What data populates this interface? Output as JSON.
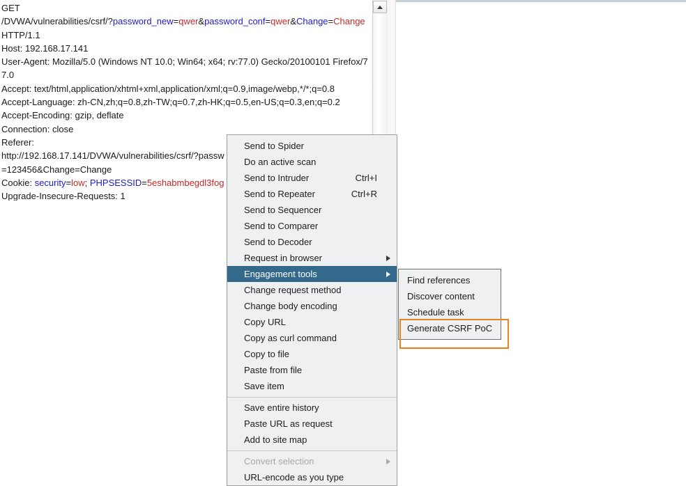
{
  "request": {
    "lines": [
      [
        {
          "t": "GET",
          "c": "plain"
        }
      ],
      [
        {
          "t": "/DVWA/vulnerabilities/csrf/?",
          "c": "plain"
        },
        {
          "t": "password_new",
          "c": "name"
        },
        {
          "t": "=",
          "c": "plain"
        },
        {
          "t": "qwer",
          "c": "value"
        },
        {
          "t": "&",
          "c": "plain"
        },
        {
          "t": "password_conf",
          "c": "name"
        },
        {
          "t": "=",
          "c": "plain"
        },
        {
          "t": "qwer",
          "c": "value"
        },
        {
          "t": "&",
          "c": "plain"
        },
        {
          "t": "Change",
          "c": "name"
        },
        {
          "t": "=",
          "c": "plain"
        },
        {
          "t": "Change",
          "c": "value"
        },
        {
          "t": " HTTP/1.1",
          "c": "plain"
        }
      ],
      [
        {
          "t": "Host: 192.168.17.141",
          "c": "plain"
        }
      ],
      [
        {
          "t": "User-Agent: Mozilla/5.0 (Windows NT 10.0; Win64; x64; rv:77.0) Gecko/20100101 Firefox/77.0",
          "c": "plain"
        }
      ],
      [
        {
          "t": "Accept: text/html,application/xhtml+xml,application/xml;q=0.9,image/webp,*/*;q=0.8",
          "c": "plain"
        }
      ],
      [
        {
          "t": "Accept-Language: zh-CN,zh;q=0.8,zh-TW;q=0.7,zh-HK;q=0.5,en-US;q=0.3,en;q=0.2",
          "c": "plain"
        }
      ],
      [
        {
          "t": "Accept-Encoding: gzip, deflate",
          "c": "plain"
        }
      ],
      [
        {
          "t": "Connection: close",
          "c": "plain"
        }
      ],
      [
        {
          "t": "Referer:",
          "c": "plain"
        }
      ],
      [
        {
          "t": "http://192.168.17.141/DVWA/vulnerabilities/csrf/?passw",
          "c": "plain"
        }
      ],
      [
        {
          "t": "=123456&Change=Change",
          "c": "plain"
        }
      ],
      [
        {
          "t": "Cookie: ",
          "c": "plain"
        },
        {
          "t": "security",
          "c": "name"
        },
        {
          "t": "=",
          "c": "plain"
        },
        {
          "t": "low",
          "c": "value"
        },
        {
          "t": "; ",
          "c": "plain"
        },
        {
          "t": "PHPSESSID",
          "c": "name"
        },
        {
          "t": "=",
          "c": "plain"
        },
        {
          "t": "5eshabmbegdl3fog",
          "c": "value"
        }
      ],
      [
        {
          "t": "Upgrade-Insecure-Requests: 1",
          "c": "plain"
        }
      ]
    ]
  },
  "scrollbar": {
    "up_arrow_icon": "triangle-up-icon"
  },
  "context_menu": {
    "items": [
      {
        "label": "Send to Spider",
        "accel": "",
        "type": "item",
        "selected": false,
        "submenu": false
      },
      {
        "label": "Do an active scan",
        "accel": "",
        "type": "item",
        "selected": false,
        "submenu": false
      },
      {
        "label": "Send to Intruder",
        "accel": "Ctrl+I",
        "type": "item",
        "selected": false,
        "submenu": false
      },
      {
        "label": "Send to Repeater",
        "accel": "Ctrl+R",
        "type": "item",
        "selected": false,
        "submenu": false
      },
      {
        "label": "Send to Sequencer",
        "accel": "",
        "type": "item",
        "selected": false,
        "submenu": false
      },
      {
        "label": "Send to Comparer",
        "accel": "",
        "type": "item",
        "selected": false,
        "submenu": false
      },
      {
        "label": "Send to Decoder",
        "accel": "",
        "type": "item",
        "selected": false,
        "submenu": false
      },
      {
        "label": "Request in browser",
        "accel": "",
        "type": "item",
        "selected": false,
        "submenu": true
      },
      {
        "label": "Engagement tools",
        "accel": "",
        "type": "item",
        "selected": true,
        "submenu": true
      },
      {
        "label": "Change request method",
        "accel": "",
        "type": "item",
        "selected": false,
        "submenu": false
      },
      {
        "label": "Change body encoding",
        "accel": "",
        "type": "item",
        "selected": false,
        "submenu": false
      },
      {
        "label": "Copy URL",
        "accel": "",
        "type": "item",
        "selected": false,
        "submenu": false
      },
      {
        "label": "Copy as curl command",
        "accel": "",
        "type": "item",
        "selected": false,
        "submenu": false
      },
      {
        "label": "Copy to file",
        "accel": "",
        "type": "item",
        "selected": false,
        "submenu": false
      },
      {
        "label": "Paste from file",
        "accel": "",
        "type": "item",
        "selected": false,
        "submenu": false
      },
      {
        "label": "Save item",
        "accel": "",
        "type": "item",
        "selected": false,
        "submenu": false
      },
      {
        "label": "",
        "accel": "",
        "type": "separator",
        "selected": false,
        "submenu": false
      },
      {
        "label": "Save entire history",
        "accel": "",
        "type": "item",
        "selected": false,
        "submenu": false
      },
      {
        "label": "Paste URL as request",
        "accel": "",
        "type": "item",
        "selected": false,
        "submenu": false
      },
      {
        "label": "Add to site map",
        "accel": "",
        "type": "item",
        "selected": false,
        "submenu": false
      },
      {
        "label": "",
        "accel": "",
        "type": "separator",
        "selected": false,
        "submenu": false
      },
      {
        "label": "Convert selection",
        "accel": "",
        "type": "disabled",
        "selected": false,
        "submenu": true
      },
      {
        "label": "URL-encode as you type",
        "accel": "",
        "type": "item",
        "selected": false,
        "submenu": false
      }
    ]
  },
  "engagement_submenu": {
    "items": [
      {
        "label": "Find references",
        "highlighted": false
      },
      {
        "label": "Discover content",
        "highlighted": false
      },
      {
        "label": "Schedule task",
        "highlighted": false
      },
      {
        "label": "Generate CSRF PoC",
        "highlighted": true
      }
    ]
  },
  "annotation": {
    "color": "#e8821e",
    "target_label": "Generate CSRF PoC"
  },
  "colors": {
    "menu_background": "#eff0f1",
    "menu_border": "#9b9d9f",
    "selection_blue": "#336a8c",
    "param_name": "#1c1ccc",
    "param_value": "#c62828",
    "annotation_orange": "#e8821e"
  }
}
